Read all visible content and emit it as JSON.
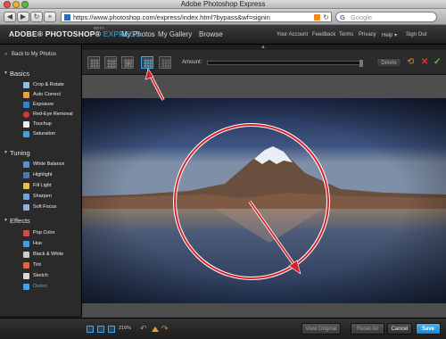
{
  "browser": {
    "title": "Adobe Photoshop Express",
    "url": "https://www.photoshop.com/express/index.html?bypass&wf=signin",
    "search_placeholder": "Google",
    "search_engine_glyph": "G",
    "back_glyph": "◀",
    "forward_glyph": "▶",
    "add_glyph": "+",
    "reload_glyph": "↻"
  },
  "app": {
    "logo_main": "ADOBE® PHOTOSHOP®",
    "logo_express": "EXPRESS",
    "logo_beta": "BETA",
    "nav": {
      "my_photos": "My Photos",
      "my_gallery": "My Gallery",
      "browse": "Browse"
    },
    "account_nav": {
      "your_account": "Your Account",
      "feedback": "Feedback",
      "terms": "Terms",
      "privacy": "Privacy",
      "help": "Help ▾",
      "sign_out": "Sign Out"
    },
    "collapse_glyph": "▲"
  },
  "sidebar": {
    "back_label": "Back to My Photos",
    "back_glyph": "«",
    "sections": {
      "basics": "Basics",
      "tuning": "Tuning",
      "effects": "Effects"
    },
    "section_glyph": "▼",
    "basics_tools": [
      "Crop & Rotate",
      "Auto Correct",
      "Exposure",
      "Red-Eye Removal",
      "Touchup",
      "Saturation"
    ],
    "tuning_tools": [
      "White Balance",
      "Highlight",
      "Fill Light",
      "Sharpen",
      "Soft Focus"
    ],
    "effects_tools": [
      "Pop Color",
      "Hue",
      "Black & White",
      "Tint",
      "Sketch",
      "Distort"
    ],
    "active_tool": "Distort",
    "accent_color": "#3fa6e6"
  },
  "options": {
    "amount_label": "Amount:",
    "amount_value": 1.0,
    "delete_label": "Delete",
    "reset_glyph": "⟲",
    "cancel_glyph": "✕",
    "apply_glyph": "✓",
    "selected_distort_mode_index": 3
  },
  "bottom": {
    "zoom": "216%",
    "undo_glyph": "↶",
    "redo_glyph": "↷",
    "view_original": "View Original",
    "reset_all": "Reset All",
    "cancel": "Cancel",
    "save": "Save"
  },
  "colors": {
    "annotation_red": "#d6222a",
    "save_blue": "#2a98dc"
  }
}
